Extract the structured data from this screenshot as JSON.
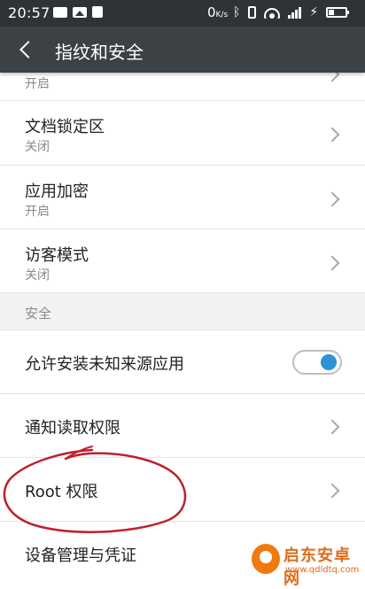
{
  "status_bar": {
    "time": "20:57",
    "net_speed": "0",
    "net_speed_unit": "K/s",
    "icons": [
      "message-icon",
      "image-icon",
      "lock-icon",
      "bluetooth-icon",
      "vibrate-icon",
      "wifi-icon",
      "signal-icon",
      "charging-icon",
      "battery-icon"
    ]
  },
  "app_bar": {
    "title": "指纹和安全",
    "back_icon": "chevron-left-icon"
  },
  "list": {
    "partial_item": {
      "subtitle": "开启"
    },
    "items": [
      {
        "title": "文档锁定区",
        "subtitle": "关闭"
      },
      {
        "title": "应用加密",
        "subtitle": "开启"
      },
      {
        "title": "访客模式",
        "subtitle": "关闭"
      }
    ],
    "section_header": "安全",
    "toggle_item": {
      "title": "允许安装未知来源应用",
      "enabled": true
    },
    "simple_items": [
      {
        "title": "通知读取权限"
      },
      {
        "title": "Root 权限"
      },
      {
        "title": "设备管理与凭证"
      }
    ]
  },
  "colors": {
    "status_bar": "#2e3336",
    "app_bar": "#3b4145",
    "toggle_on": "#2d93d6",
    "annotation": "#c0202b",
    "watermark": "#e06b1a"
  },
  "watermark": {
    "name": "启东安卓网",
    "url": "www.qdldtq.com"
  }
}
